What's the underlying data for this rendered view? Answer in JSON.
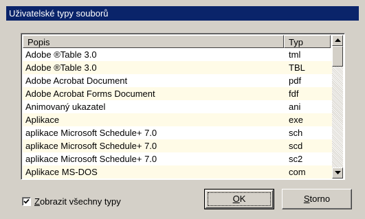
{
  "window": {
    "title": "Uživatelské typy souborů"
  },
  "list": {
    "columns": {
      "popis": "Popis",
      "typ": "Typ"
    },
    "rows": [
      {
        "popis": "Adobe ®Table 3.0",
        "typ": "tml"
      },
      {
        "popis": "Adobe ®Table 3.0",
        "typ": "TBL"
      },
      {
        "popis": "Adobe Acrobat Document",
        "typ": "pdf"
      },
      {
        "popis": "Adobe Acrobat Forms Document",
        "typ": "fdf"
      },
      {
        "popis": "Animovaný ukazatel",
        "typ": "ani"
      },
      {
        "popis": "Aplikace",
        "typ": "exe"
      },
      {
        "popis": "aplikace Microsoft Schedule+ 7.0",
        "typ": "sch"
      },
      {
        "popis": "aplikace Microsoft Schedule+ 7.0",
        "typ": "scd"
      },
      {
        "popis": "aplikace Microsoft Schedule+ 7.0",
        "typ": "sc2"
      },
      {
        "popis": "Aplikace MS-DOS",
        "typ": "com"
      }
    ]
  },
  "show_all": {
    "accesskey": "Z",
    "label_rest": "obrazit všechny typy",
    "checked": true
  },
  "buttons": {
    "ok": {
      "accesskey": "O",
      "label_rest": "K"
    },
    "storno": {
      "accesskey": "S",
      "label_rest": "torno"
    }
  },
  "colors": {
    "titlebar": "#0a246a",
    "row_alt": "#fffbe7",
    "face": "#d4d0c8"
  }
}
